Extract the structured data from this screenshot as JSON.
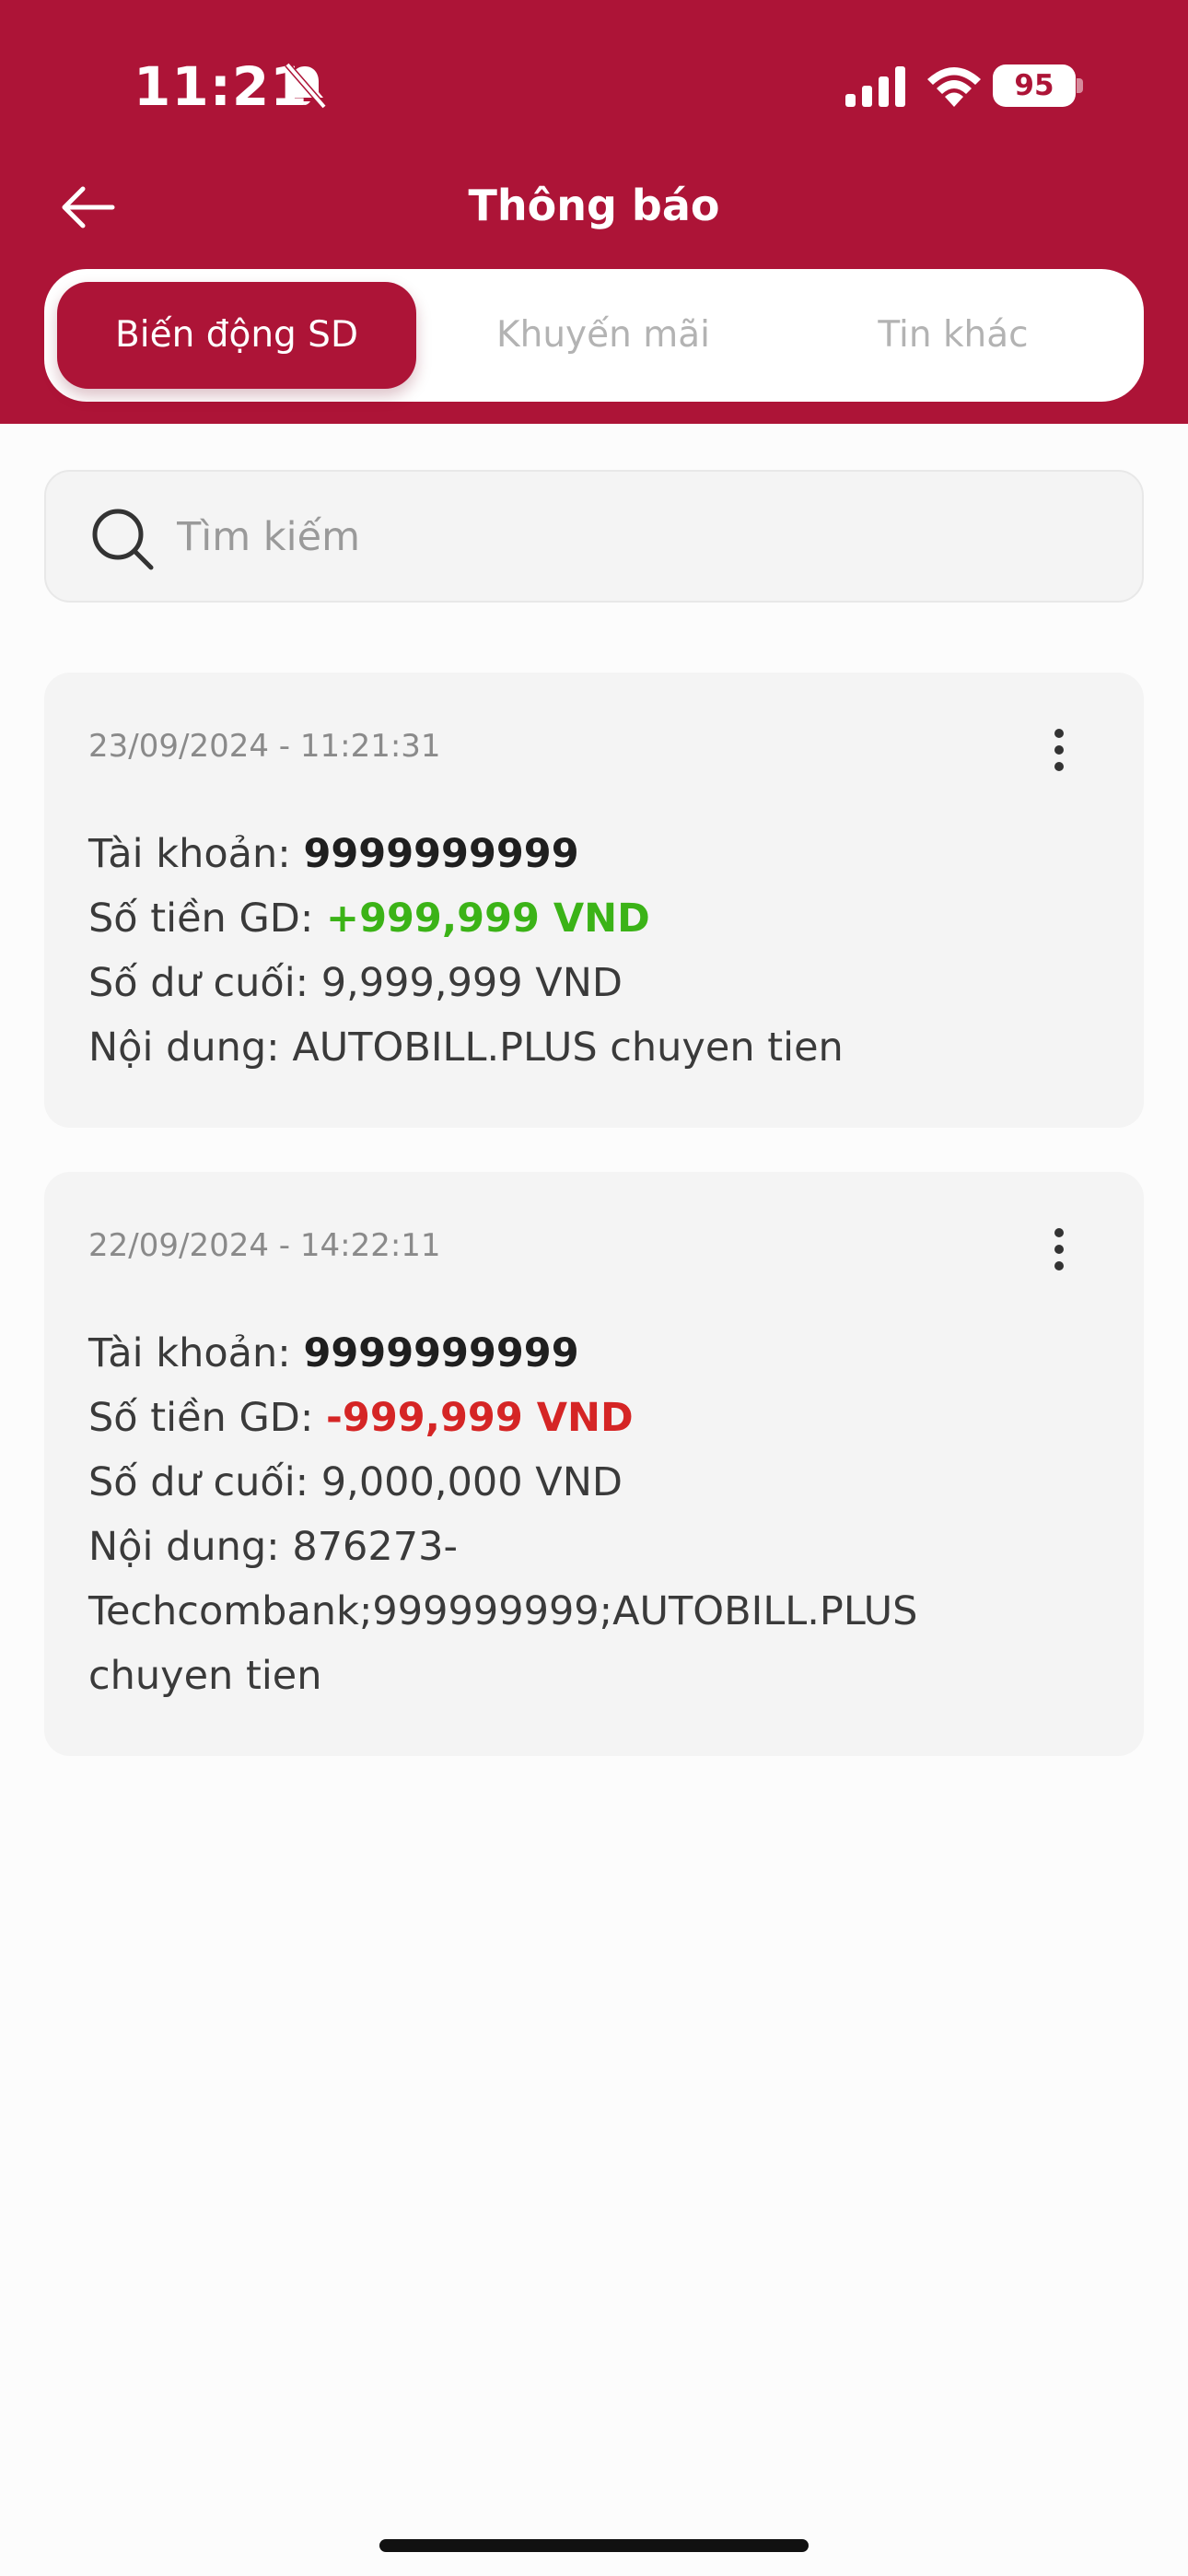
{
  "status_bar": {
    "time": "11:21",
    "battery": "95"
  },
  "header": {
    "title": "Thông báo"
  },
  "tabs": [
    {
      "label": "Biến động SD",
      "active": true
    },
    {
      "label": "Khuyến mãi",
      "active": false
    },
    {
      "label": "Tin khác",
      "active": false
    }
  ],
  "search": {
    "placeholder": "Tìm kiếm",
    "value": ""
  },
  "notifications": [
    {
      "timestamp": "23/09/2024 - 11:21:31",
      "account_label": "Tài khoản: ",
      "account": "9999999999",
      "amount_label": "Số tiền GD: ",
      "amount": "+999,999 VND",
      "balance_label": "Số dư cuối: ",
      "balance": "9,999,999 VND",
      "content_label": "Nội dung: ",
      "content": "AUTOBILL.PLUS chuyen tien"
    },
    {
      "timestamp": "22/09/2024 - 14:22:11",
      "account_label": "Tài khoản: ",
      "account": "9999999999",
      "amount_label": "Số tiền GD: ",
      "amount": "-999,999 VND",
      "balance_label": "Số dư cuối: ",
      "balance": "9,000,000 VND",
      "content_label": "Nội dung: ",
      "content_line1": "876273-",
      "content_line2": "Techcombank;999999999;AUTOBILL.PLUS",
      "content_line3": "chuyen tien"
    }
  ],
  "colors": {
    "brand": "#ad1437",
    "positive": "#3bb317",
    "negative": "#d52525"
  },
  "icons": [
    "bell-off-icon",
    "signal-icon",
    "wifi-icon",
    "battery-icon",
    "back-arrow-icon",
    "search-icon",
    "more-vertical-icon"
  ]
}
